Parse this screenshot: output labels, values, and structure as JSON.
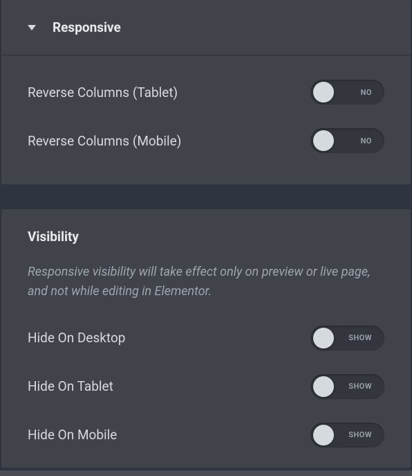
{
  "responsive": {
    "title": "Responsive",
    "reverse_tablet": {
      "label": "Reverse Columns (Tablet)",
      "state": "NO"
    },
    "reverse_mobile": {
      "label": "Reverse Columns (Mobile)",
      "state": "NO"
    }
  },
  "visibility": {
    "title": "Visibility",
    "note": "Responsive visibility will take effect only on preview or live page, and not while editing in Elementor.",
    "hide_desktop": {
      "label": "Hide On Desktop",
      "state": "SHOW"
    },
    "hide_tablet": {
      "label": "Hide On Tablet",
      "state": "SHOW"
    },
    "hide_mobile": {
      "label": "Hide On Mobile",
      "state": "SHOW"
    }
  }
}
